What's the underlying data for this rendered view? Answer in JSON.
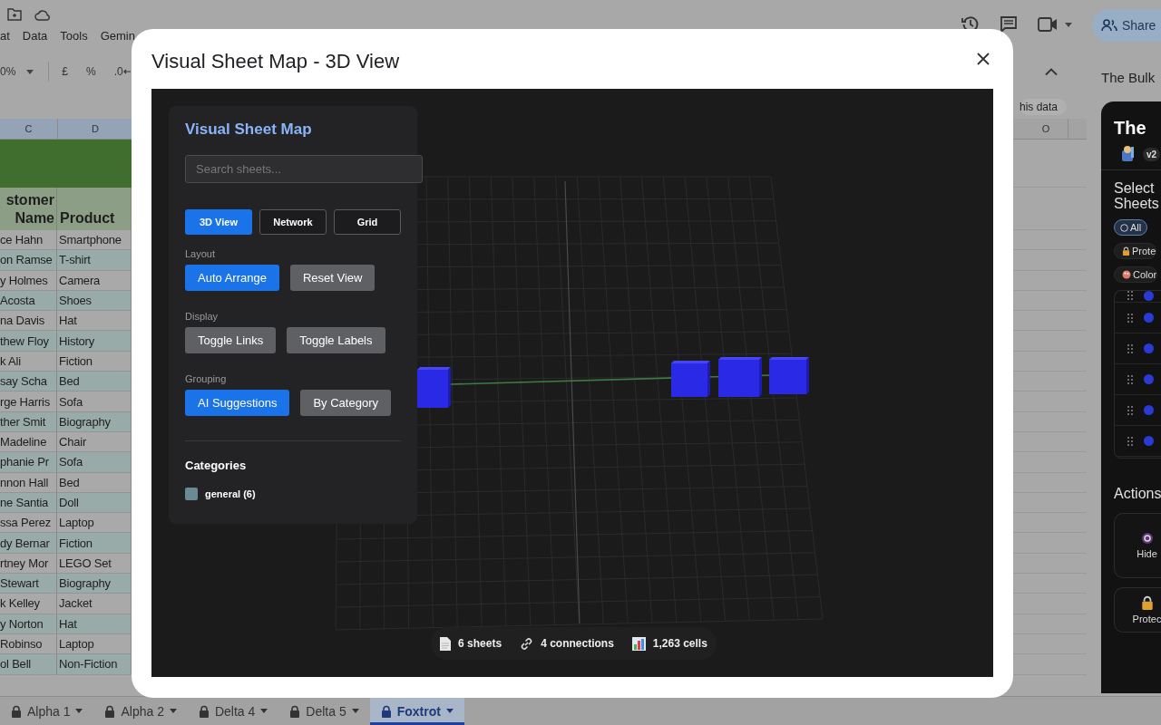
{
  "menu_bar": {
    "items": [
      "at",
      "Data",
      "Tools",
      "Gemin"
    ]
  },
  "toolbar": {
    "zoom": "0%",
    "items": [
      {
        "label": "£",
        "kind": "plain"
      },
      {
        "label": "%",
        "kind": "plain"
      },
      {
        "label": ".0",
        "kind": "decimal"
      }
    ]
  },
  "share_button": {
    "label": "Share"
  },
  "sheet": {
    "columns": [
      "C",
      "D",
      "O"
    ],
    "chip": "his data",
    "header": {
      "customer": "stomer Name",
      "product": "Product"
    },
    "rows": [
      {
        "customer": "ce Hahn",
        "product": "Smartphone"
      },
      {
        "customer": "on Ramse",
        "product": "T-shirt"
      },
      {
        "customer": "y Holmes",
        "product": "Camera"
      },
      {
        "customer": "Acosta",
        "product": "Shoes"
      },
      {
        "customer": "na Davis",
        "product": "Hat"
      },
      {
        "customer": "thew Floy",
        "product": "History"
      },
      {
        "customer": "k Ali",
        "product": "Fiction"
      },
      {
        "customer": "say Scha",
        "product": "Bed"
      },
      {
        "customer": "rge Harris",
        "product": "Sofa"
      },
      {
        "customer": "ther Smit",
        "product": "Biography"
      },
      {
        "customer": "Madeline",
        "product": "Chair"
      },
      {
        "customer": "phanie Pr",
        "product": "Sofa"
      },
      {
        "customer": "nnon Hall",
        "product": "Bed"
      },
      {
        "customer": "ne Santia",
        "product": "Doll"
      },
      {
        "customer": "ssa Perez",
        "product": "Laptop"
      },
      {
        "customer": "dy Bernar",
        "product": "Fiction"
      },
      {
        "customer": "rtney Mor",
        "product": "LEGO Set"
      },
      {
        "customer": "Stewart",
        "product": "Biography"
      },
      {
        "customer": "k Kelley",
        "product": "Jacket"
      },
      {
        "customer": "y Norton",
        "product": "Hat"
      },
      {
        "customer": "Robinso",
        "product": "Laptop"
      },
      {
        "customer": "ol Bell",
        "product": "Non-Fiction"
      }
    ]
  },
  "side_panel": {
    "title": "The Bulk",
    "app_title": "The",
    "version": "v2",
    "select_label": "Select Sheets",
    "filters": [
      {
        "label": "All",
        "kind": "radio",
        "selected": true
      },
      {
        "label": "Prote",
        "kind": "lock",
        "selected": false
      },
      {
        "label": "Color",
        "kind": "palette",
        "selected": false
      }
    ],
    "sheet_rows": [
      {
        "checked": true
      },
      {
        "checked": true
      },
      {
        "checked": true
      },
      {
        "checked": true
      },
      {
        "checked": true
      },
      {
        "checked": true
      }
    ],
    "actions_label": "Actions",
    "actions": [
      {
        "label": "Hide",
        "kind": "hide"
      },
      {
        "label": "Protec",
        "kind": "protect"
      }
    ]
  },
  "sheet_tabs": [
    {
      "label": "Alpha 1",
      "selected": false
    },
    {
      "label": "Alpha 2",
      "selected": false
    },
    {
      "label": "Delta 4",
      "selected": false
    },
    {
      "label": "Delta 5",
      "selected": false
    },
    {
      "label": "Foxtrot",
      "selected": true
    }
  ],
  "dialog": {
    "title": "Visual Sheet Map - 3D View",
    "panel": {
      "title": "Visual Sheet Map",
      "search": {
        "placeholder": "Search sheets..."
      },
      "view_modes": [
        {
          "label": "3D View",
          "selected": true
        },
        {
          "label": "Network",
          "selected": false
        },
        {
          "label": "Grid",
          "selected": false
        }
      ],
      "groups": [
        {
          "label": "Layout",
          "buttons": [
            {
              "label": "Auto Arrange",
              "active": true
            },
            {
              "label": "Reset View",
              "active": false
            }
          ]
        },
        {
          "label": "Display",
          "buttons": [
            {
              "label": "Toggle Links",
              "active": false
            },
            {
              "label": "Toggle Labels",
              "active": false
            }
          ]
        },
        {
          "label": "Grouping",
          "buttons": [
            {
              "label": "AI Suggestions",
              "active": true
            },
            {
              "label": "By Category",
              "active": false
            }
          ]
        }
      ],
      "categories_heading": "Categories",
      "categories": [
        {
          "label": "general (6)",
          "color": "#6b8a94"
        }
      ]
    },
    "stats": [
      {
        "kind": "sheets",
        "text": "6 sheets"
      },
      {
        "kind": "connections",
        "text": "4 connections"
      },
      {
        "kind": "cells",
        "text": "1,263 cells"
      }
    ]
  }
}
